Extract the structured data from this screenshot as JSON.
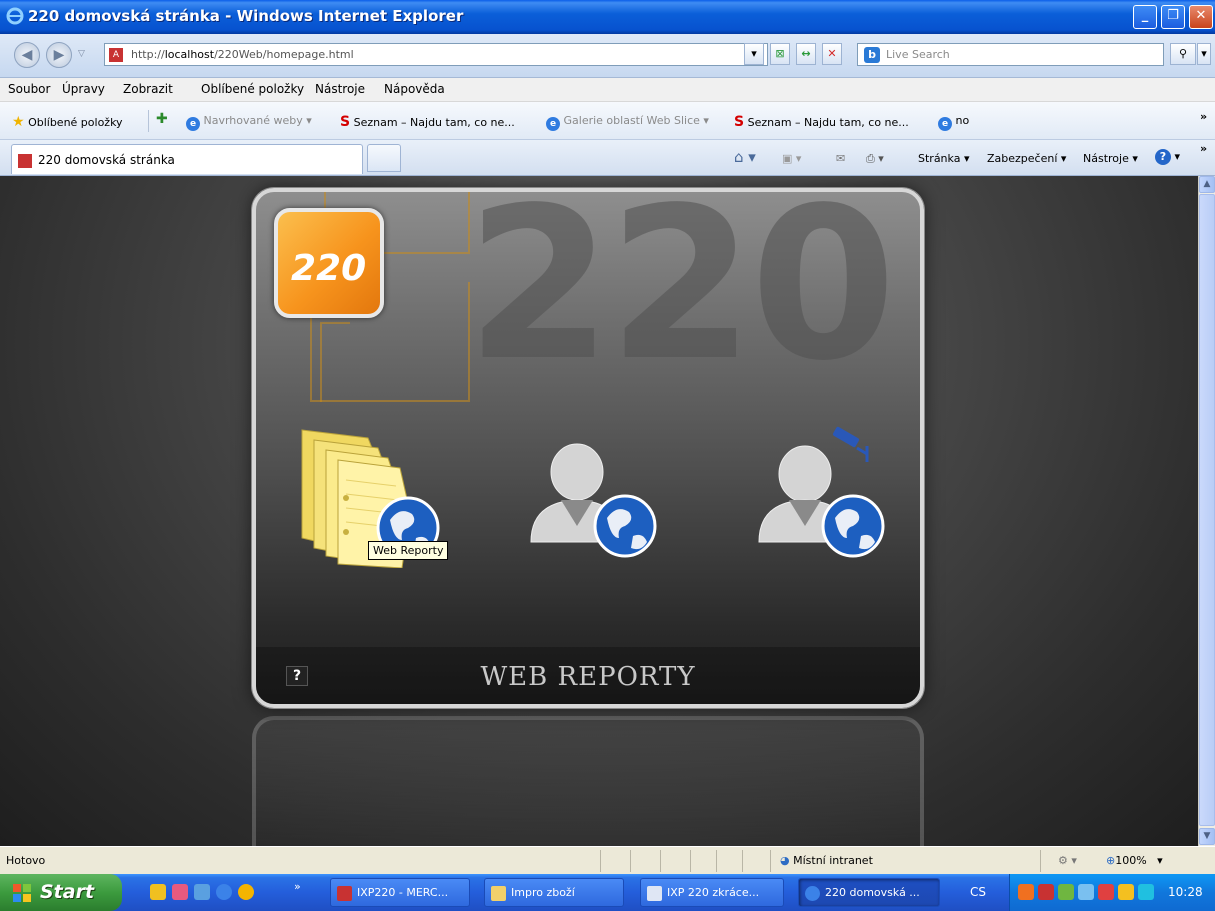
{
  "window": {
    "title": "220 domovská stránka - Windows Internet Explorer"
  },
  "address": {
    "url_prefix": "http://",
    "url_host": "localhost",
    "url_path": "/220Web/homepage.html"
  },
  "search": {
    "placeholder": "Live Search"
  },
  "menu": [
    "Soubor",
    "Úpravy",
    "Zobrazit",
    "Oblíbené položky",
    "Nástroje",
    "Nápověda"
  ],
  "favorites": {
    "label": "Oblíbené položky",
    "items": [
      "Navrhované weby ▾",
      "Seznam – Najdu tam, co ne...",
      "Galerie oblastí Web Slice ▾",
      "Seznam – Najdu tam, co ne...",
      "no"
    ]
  },
  "tab": {
    "label": "220 domovská stránka"
  },
  "commands": {
    "page": "Stránka ▾",
    "security": "Zabezpečení ▾",
    "tools": "Nástroje ▾"
  },
  "page": {
    "logo_text": "220",
    "watermark": "220",
    "title": "WEB REPORTY",
    "help": "?",
    "tooltip": "Web Reporty"
  },
  "status": {
    "text": "Hotovo",
    "zone": "Místní intranet",
    "zoom": "100%"
  },
  "taskbar": {
    "start": "Start",
    "buttons": [
      "IXP220 - MERC...",
      "Impro zboží",
      "IXP 220 zkráce...",
      "220 domovská ..."
    ],
    "lang": "CS",
    "clock": "10:28"
  },
  "colors": {
    "accent": "#f7941d",
    "titlebar": "#0b5fd9",
    "taskbar": "#245edb",
    "start": "#3c9b3e"
  }
}
